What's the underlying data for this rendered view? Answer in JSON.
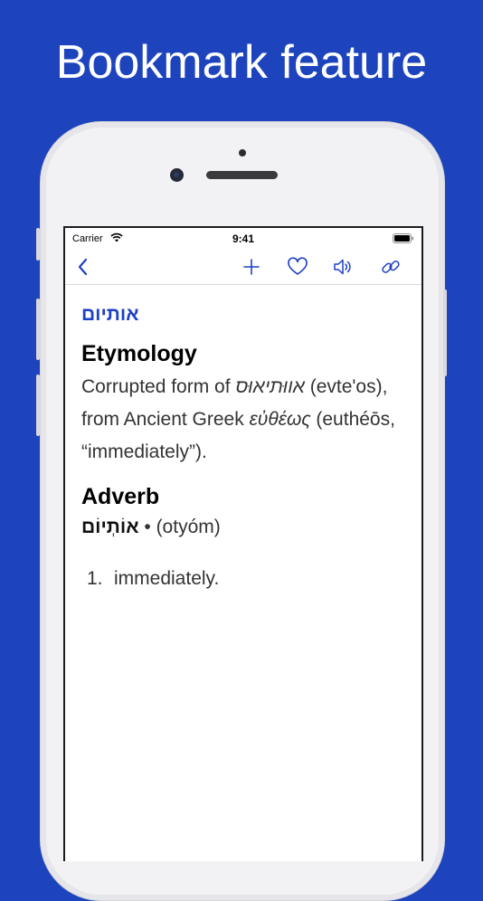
{
  "headline": "Bookmark feature",
  "status": {
    "carrier": "Carrier",
    "time": "9:41"
  },
  "nav": {
    "icons": [
      "back-chevron-icon",
      "plus-icon",
      "heart-icon",
      "speaker-icon",
      "link-icon"
    ]
  },
  "entry": {
    "headword": "אותיום",
    "etymology_heading": "Etymology",
    "etymology": {
      "part1": "Corrupted form of ",
      "hebrew": "אווּתיאוּס",
      "part2": " (evte'os), from Ancient Greek ",
      "greek": "εὐθέως",
      "part3": " (euthéōs, “immediately”)."
    },
    "pos_heading": "Adverb",
    "inflection": {
      "word": "אוֹתְיוֹם",
      "rest": " • (otyóm)"
    },
    "definitions": [
      {
        "num": "1.",
        "text": "immediately."
      }
    ]
  },
  "colors": {
    "background": "#1d44bd",
    "accent": "#1d40c4"
  }
}
